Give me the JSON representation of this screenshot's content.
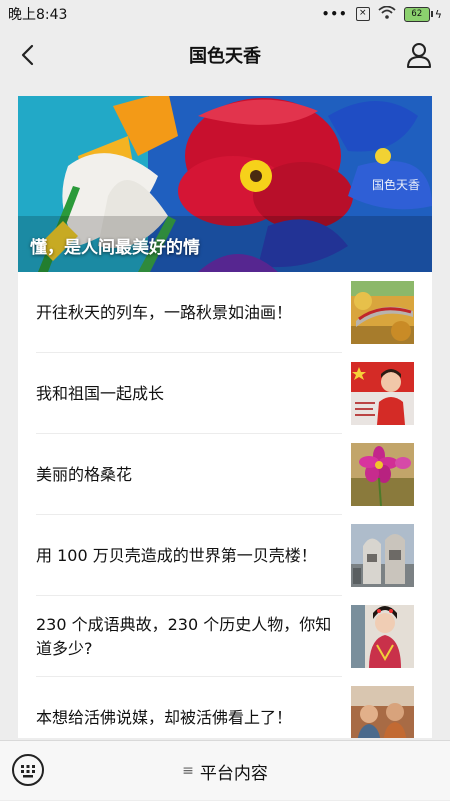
{
  "status": {
    "time": "晚上8:43",
    "signal_dots": "•••",
    "battery": "62"
  },
  "nav": {
    "title": "国色天香"
  },
  "banner": {
    "watermark": "国色天香",
    "caption": "懂，是人间最美好的情"
  },
  "articles": [
    {
      "title": "开往秋天的列车，一路秋景如油画！",
      "thumb_icon": "train-photo"
    },
    {
      "title": "我和祖国一起成长",
      "thumb_icon": "child-flag-photo"
    },
    {
      "title": "美丽的格桑花",
      "thumb_icon": "flower-photo"
    },
    {
      "title": "用 100 万贝壳造成的世界第一贝壳楼！",
      "thumb_icon": "building-photo"
    },
    {
      "title": "230 个成语典故，230 个历史人物，你知道多少?",
      "thumb_icon": "costume-photo"
    },
    {
      "title": "本想给活佛说媒，却被活佛看上了！",
      "thumb_icon": "people-photo"
    }
  ],
  "bottom": {
    "menu_icon": "≡",
    "menu_label": "平台内容"
  }
}
